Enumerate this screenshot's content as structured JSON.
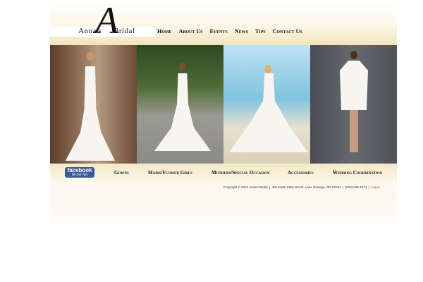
{
  "brand": {
    "letter": "A",
    "name_left": "Anna's",
    "name_right": "Bridal"
  },
  "nav": [
    "Home",
    "About Us",
    "Events",
    "News",
    "Tips",
    "Contact Us"
  ],
  "photos": [
    "bridal-gown-back",
    "bridal-gown-forest",
    "bridal-gown-beach",
    "short-dress"
  ],
  "facebook": {
    "title": "facebook",
    "sub": "be our fan"
  },
  "bottom_nav": [
    "Gowns",
    "Maids/Flower Girls",
    "Mothers/Special Occasion",
    "Accessories",
    "Wedding Coordination"
  ],
  "footer": {
    "copyright": "Copyright © 2014 Anna's Bridal",
    "address": "402 North State Street, Lake Oswego, OR 97034",
    "phone": "(503) 636-1474",
    "login": "Log in"
  }
}
